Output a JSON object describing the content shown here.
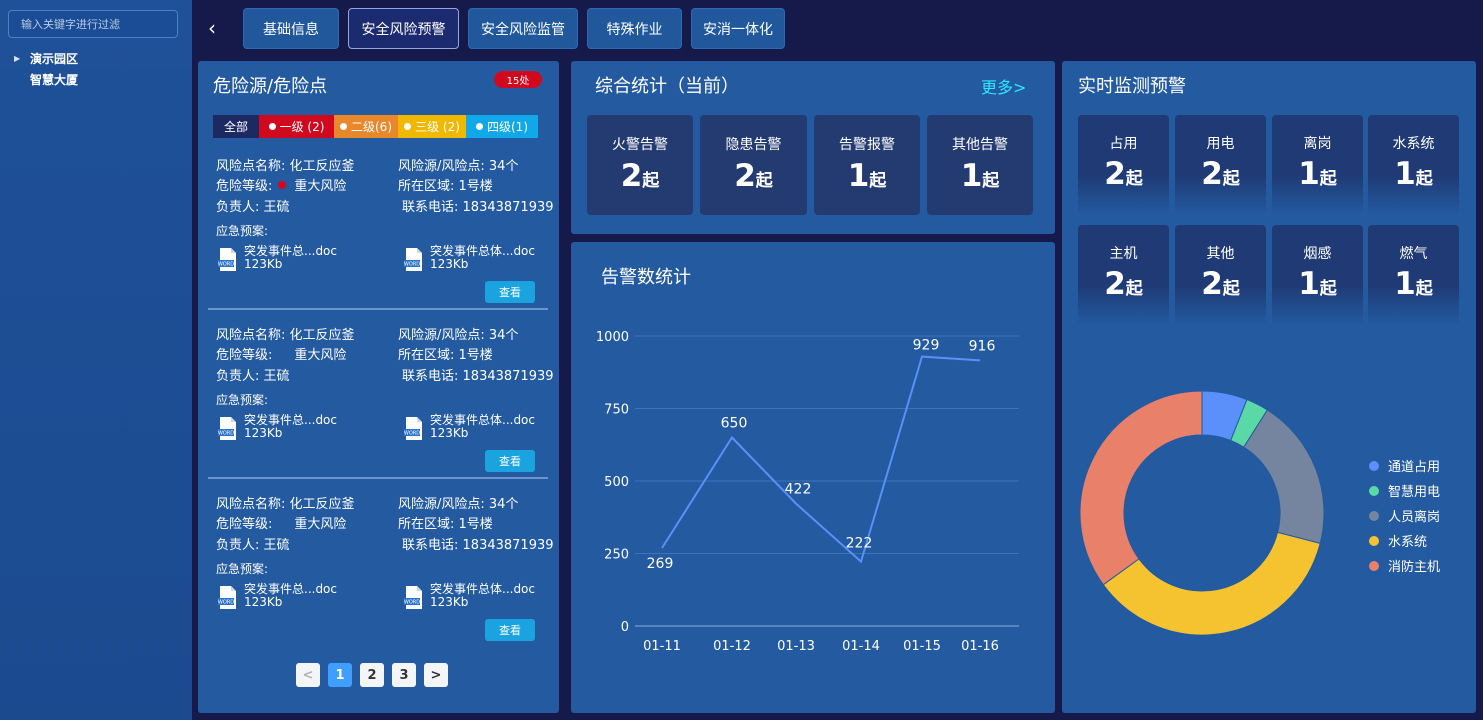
{
  "sidebar": {
    "filter_placeholder": "输入关键字进行过滤",
    "tree": {
      "root": "演示园区",
      "child": "智慧大厦"
    }
  },
  "nav": {
    "tabs": [
      {
        "label": "基础信息"
      },
      {
        "label": "安全风险预警"
      },
      {
        "label": "安全风险监管"
      },
      {
        "label": "特殊作业"
      },
      {
        "label": "安消一体化"
      }
    ],
    "active_tab": "安全风险预警"
  },
  "hazards": {
    "title": "危险源/危险点",
    "count_badge": "15处",
    "levels": [
      {
        "label": "全部"
      },
      {
        "label": "一级 (2)"
      },
      {
        "label": "二级(6)"
      },
      {
        "label": "三级 (2)"
      },
      {
        "label": "四级(1)"
      }
    ],
    "cards": [
      {
        "point_name_label": "风险点名称:",
        "point_name": "化工反应釜",
        "source_count_label": "风险源/风险点:",
        "source_count": "34个",
        "level_label": "危险等级:",
        "level": "重大风险",
        "area_label": "所在区域:",
        "area": "1号楼",
        "owner_label": "负责人:",
        "owner": "王硫",
        "phone_label": "联系电话:",
        "phone": "18343871939",
        "plan_label": "应急预案:",
        "files": [
          {
            "name": "突发事件总...doc",
            "size": "123Kb"
          },
          {
            "name": "突发事件总体...doc",
            "size": "123Kb"
          }
        ],
        "view_label": "查看"
      },
      {
        "point_name_label": "风险点名称:",
        "point_name": "化工反应釜",
        "source_count_label": "风险源/风险点:",
        "source_count": "34个",
        "level_label": "危险等级:",
        "level": "重大风险",
        "area_label": "所在区域:",
        "area": "1号楼",
        "owner_label": "负责人:",
        "owner": "王硫",
        "phone_label": "联系电话:",
        "phone": "18343871939",
        "plan_label": "应急预案:",
        "files": [
          {
            "name": "突发事件总...doc",
            "size": "123Kb"
          },
          {
            "name": "突发事件总体...doc",
            "size": "123Kb"
          }
        ],
        "view_label": "查看"
      },
      {
        "point_name_label": "风险点名称:",
        "point_name": "化工反应釜",
        "source_count_label": "风险源/风险点:",
        "source_count": "34个",
        "level_label": "危险等级:",
        "level": "重大风险",
        "area_label": "所在区域:",
        "area": "1号楼",
        "owner_label": "负责人:",
        "owner": "王硫",
        "phone_label": "联系电话:",
        "phone": "18343871939",
        "plan_label": "应急预案:",
        "files": [
          {
            "name": "突发事件总...doc",
            "size": "123Kb"
          },
          {
            "name": "突发事件总体...doc",
            "size": "123Kb"
          }
        ],
        "view_label": "查看"
      }
    ],
    "pager": {
      "prev": "<",
      "pages": [
        "1",
        "2",
        "3"
      ],
      "next": ">",
      "current": "1"
    }
  },
  "stats": {
    "title": "综合统计（当前）",
    "more": "更多>",
    "unit": "起",
    "items": [
      {
        "label": "火警告警",
        "value": "2"
      },
      {
        "label": "隐患告警",
        "value": "2"
      },
      {
        "label": "告警报警",
        "value": "1"
      },
      {
        "label": "其他告警",
        "value": "1"
      }
    ]
  },
  "alarm_chart": {
    "title": "告警数统计"
  },
  "monitor": {
    "title": "实时监测预警",
    "unit": "起",
    "items": [
      {
        "label": "占用",
        "value": "2"
      },
      {
        "label": "用电",
        "value": "2"
      },
      {
        "label": "离岗",
        "value": "1"
      },
      {
        "label": "水系统",
        "value": "1"
      },
      {
        "label": "主机",
        "value": "2"
      },
      {
        "label": "其他",
        "value": "2"
      },
      {
        "label": "烟感",
        "value": "1"
      },
      {
        "label": "燃气",
        "value": "1"
      }
    ]
  },
  "colors": {
    "series_line": "#5b8ff9",
    "donut": [
      "#5b8ff9",
      "#5ad8a6",
      "#7585a0",
      "#f6c330",
      "#e8806a"
    ]
  },
  "chart_data": [
    {
      "type": "line",
      "title": "告警数统计",
      "categories": [
        "01-11",
        "01-12",
        "01-13",
        "01-14",
        "01-15",
        "01-16"
      ],
      "values": [
        269,
        650,
        422,
        222,
        929,
        916
      ],
      "ylim": [
        0,
        1000
      ],
      "yticks": [
        0,
        250,
        500,
        750,
        1000
      ],
      "grid": true,
      "data_labels": true
    },
    {
      "type": "pie",
      "donut": true,
      "labels": [
        "通道占用",
        "智慧用电",
        "人员离岗",
        "水系统",
        "消防主机"
      ],
      "values": [
        6,
        3,
        20,
        36,
        35
      ],
      "legend_position": "right"
    }
  ]
}
